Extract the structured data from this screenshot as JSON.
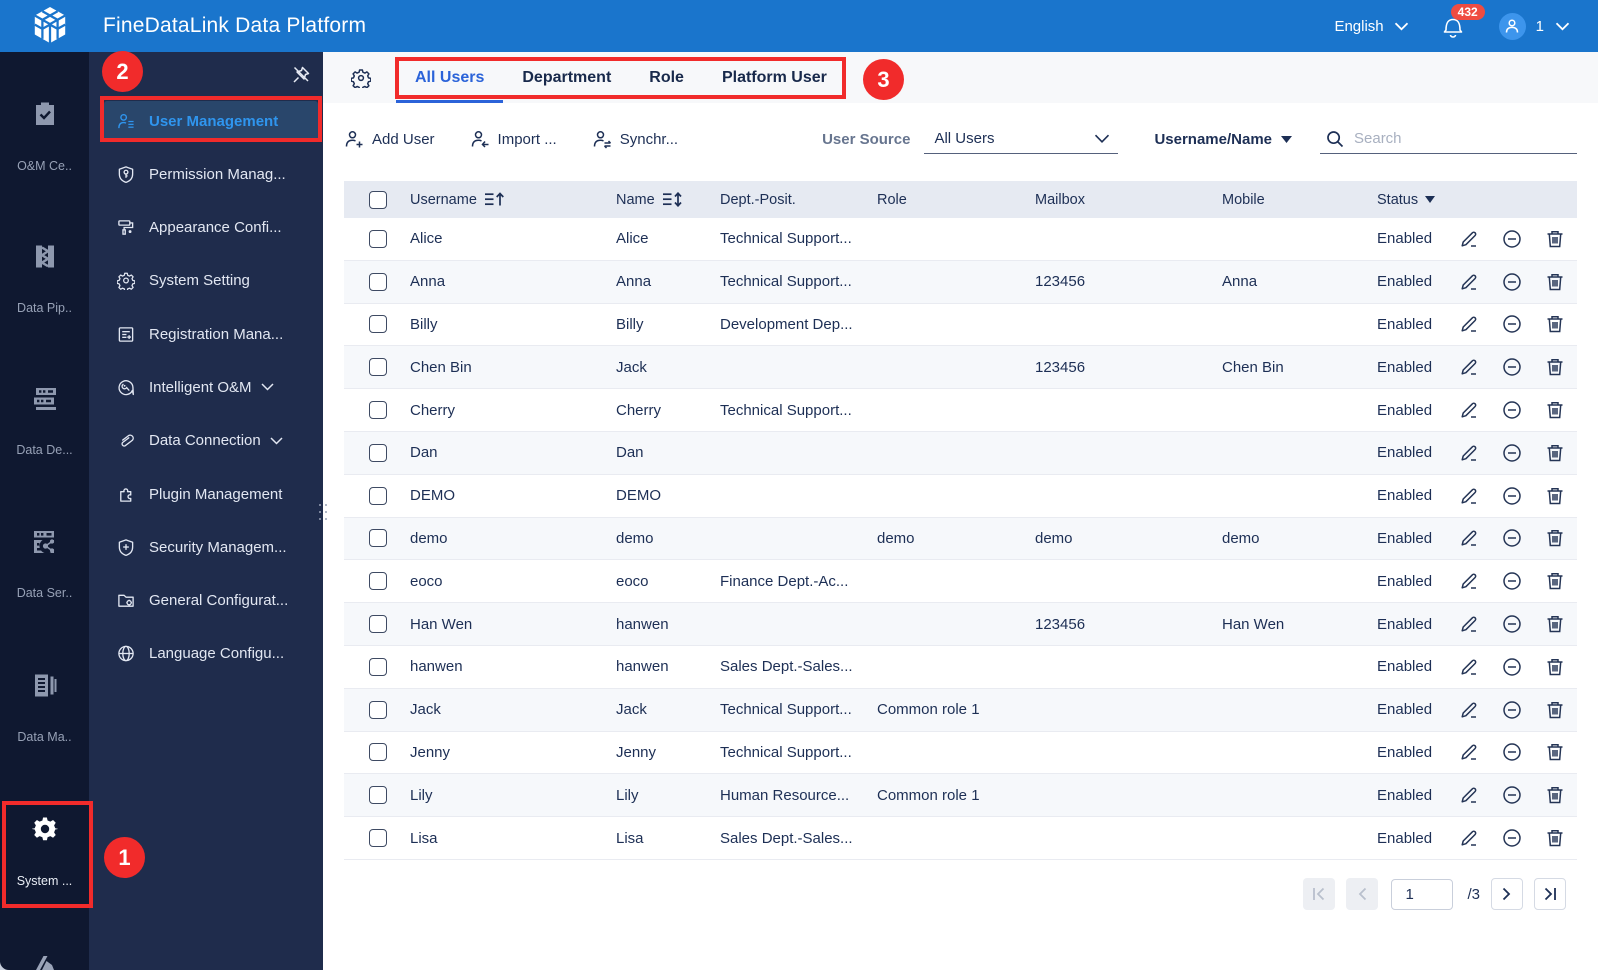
{
  "topbar": {
    "title": "FineDataLink Data Platform",
    "language": "English",
    "notification_count": "432",
    "user_count": "1"
  },
  "rail": {
    "items": [
      {
        "label": "O&M Ce..",
        "icon": "clipboard-check-icon",
        "active": false
      },
      {
        "label": "Data Pip..",
        "icon": "pipeline-icon",
        "active": false
      },
      {
        "label": "Data De...",
        "icon": "server-stack-icon",
        "active": false
      },
      {
        "label": "Data Ser..",
        "icon": "server-share-icon",
        "active": false
      },
      {
        "label": "Data Ma..",
        "icon": "ledger-icon",
        "active": false
      },
      {
        "label": "System ...",
        "icon": "gear-icon",
        "active": true
      }
    ]
  },
  "submenu": {
    "items": [
      {
        "label": "User Management",
        "icon": "user-list-icon",
        "active": true,
        "chevron": false
      },
      {
        "label": "Permission Manag...",
        "icon": "shield-key-icon",
        "active": false,
        "chevron": false
      },
      {
        "label": "Appearance Confi...",
        "icon": "paint-roller-icon",
        "active": false,
        "chevron": false
      },
      {
        "label": "System Setting",
        "icon": "gear-outline-icon",
        "active": false,
        "chevron": false
      },
      {
        "label": "Registration Mana...",
        "icon": "document-plus-icon",
        "active": false,
        "chevron": false
      },
      {
        "label": "Intelligent O&M",
        "icon": "wrench-badge-icon",
        "active": false,
        "chevron": true
      },
      {
        "label": "Data Connection",
        "icon": "paperclip-icon",
        "active": false,
        "chevron": true
      },
      {
        "label": "Plugin Management",
        "icon": "puzzle-icon",
        "active": false,
        "chevron": false
      },
      {
        "label": "Security Managem...",
        "icon": "shield-plus-icon",
        "active": false,
        "chevron": false
      },
      {
        "label": "General Configurat...",
        "icon": "folder-gear-icon",
        "active": false,
        "chevron": false
      },
      {
        "label": "Language Configu...",
        "icon": "globe-icon",
        "active": false,
        "chevron": false
      }
    ]
  },
  "tabs": {
    "items": [
      {
        "label": "All Users",
        "active": true
      },
      {
        "label": "Department",
        "active": false
      },
      {
        "label": "Role",
        "active": false
      },
      {
        "label": "Platform User",
        "active": false
      }
    ]
  },
  "toolbar": {
    "add_user_label": "Add User",
    "import_label": "Import ...",
    "sync_label": "Synchr...",
    "user_source_label": "User Source",
    "user_source_value": "All Users",
    "sort_field_label": "Username/Name",
    "search_placeholder": "Search"
  },
  "table": {
    "columns": {
      "username": "Username",
      "name": "Name",
      "dept": "Dept.-Posit.",
      "role": "Role",
      "mailbox": "Mailbox",
      "mobile": "Mobile",
      "status": "Status"
    },
    "rows": [
      {
        "username": "Alice",
        "name": "Alice",
        "dept": "Technical Support...",
        "role": "",
        "mailbox": "",
        "mobile": "",
        "status": "Enabled"
      },
      {
        "username": "Anna",
        "name": "Anna",
        "dept": "Technical Support...",
        "role": "",
        "mailbox": "123456",
        "mobile": "Anna",
        "status": "Enabled"
      },
      {
        "username": "Billy",
        "name": "Billy",
        "dept": "Development Dep...",
        "role": "",
        "mailbox": "",
        "mobile": "",
        "status": "Enabled"
      },
      {
        "username": "Chen Bin",
        "name": "Jack",
        "dept": "",
        "role": "",
        "mailbox": "123456",
        "mobile": "Chen Bin",
        "status": "Enabled"
      },
      {
        "username": "Cherry",
        "name": "Cherry",
        "dept": "Technical Support...",
        "role": "",
        "mailbox": "",
        "mobile": "",
        "status": "Enabled"
      },
      {
        "username": "Dan",
        "name": "Dan",
        "dept": "",
        "role": "",
        "mailbox": "",
        "mobile": "",
        "status": "Enabled"
      },
      {
        "username": "DEMO",
        "name": "DEMO",
        "dept": "",
        "role": "",
        "mailbox": "",
        "mobile": "",
        "status": "Enabled"
      },
      {
        "username": "demo",
        "name": "demo",
        "dept": "",
        "role": "demo",
        "mailbox": "demo",
        "mobile": "demo",
        "status": "Enabled"
      },
      {
        "username": "eoco",
        "name": "eoco",
        "dept": "Finance Dept.-Ac...",
        "role": "",
        "mailbox": "",
        "mobile": "",
        "status": "Enabled"
      },
      {
        "username": "Han Wen",
        "name": "hanwen",
        "dept": "",
        "role": "",
        "mailbox": "123456",
        "mobile": "Han Wen",
        "status": "Enabled"
      },
      {
        "username": "hanwen",
        "name": "hanwen",
        "dept": "Sales Dept.-Sales...",
        "role": "",
        "mailbox": "",
        "mobile": "",
        "status": "Enabled"
      },
      {
        "username": "Jack",
        "name": "Jack",
        "dept": "Technical Support...",
        "role": "Common role 1",
        "mailbox": "",
        "mobile": "",
        "status": "Enabled"
      },
      {
        "username": "Jenny",
        "name": "Jenny",
        "dept": "Technical Support...",
        "role": "",
        "mailbox": "",
        "mobile": "",
        "status": "Enabled"
      },
      {
        "username": "Lily",
        "name": "Lily",
        "dept": "Human Resource...",
        "role": "Common role 1",
        "mailbox": "",
        "mobile": "",
        "status": "Enabled"
      },
      {
        "username": "Lisa",
        "name": "Lisa",
        "dept": "Sales Dept.-Sales...",
        "role": "",
        "mailbox": "",
        "mobile": "",
        "status": "Enabled"
      }
    ]
  },
  "pagination": {
    "page": "1",
    "total": "/3"
  },
  "annotations": {
    "step1": "1",
    "step2": "2",
    "step3": "3"
  },
  "colors": {
    "topbar_blue": "#1A75CC",
    "rail_bg": "#0F1830",
    "submenu_bg": "#1F2C4C",
    "active_item_bg": "#29466B",
    "active_item_text": "#2F95EE",
    "tab_active_blue": "#2B63D9",
    "table_header_bg": "#E6EAF2",
    "row_alt_bg": "#F6F8FB",
    "text_navy": "#1D2F55",
    "badge_red": "#EF4C41",
    "annotation_red": "#F12B2B"
  }
}
